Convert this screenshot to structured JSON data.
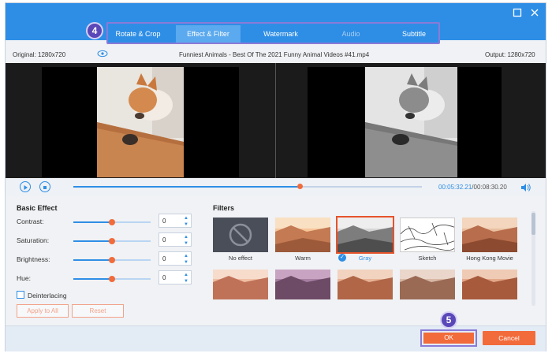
{
  "window": {
    "controls": [
      "maximize-icon",
      "close-icon"
    ],
    "accent": "#2e8ee6"
  },
  "tabs": [
    {
      "label": "Rotate & Crop"
    },
    {
      "label": "Effect & Filter",
      "active": true
    },
    {
      "label": "Watermark"
    },
    {
      "label": "Audio",
      "dimmed": true
    },
    {
      "label": "Subtitle"
    }
  ],
  "badges": {
    "tabs_step": "4",
    "ok_step": "5"
  },
  "info": {
    "original": "Original: 1280x720",
    "filename": "Funniest Animals - Best Of The 2021 Funny Animal Videos #41.mp4",
    "output": "Output: 1280x720"
  },
  "playback": {
    "current_time": "00:05:32.21",
    "separator": "/",
    "total_time": "00:08:30.20",
    "progress": 0.65
  },
  "basic_effect": {
    "title": "Basic Effect",
    "sliders": [
      {
        "label": "Contrast:",
        "value": "0",
        "level": 0.5
      },
      {
        "label": "Saturation:",
        "value": "0",
        "level": 0.5
      },
      {
        "label": "Brightness:",
        "value": "0",
        "level": 0.5
      },
      {
        "label": "Hue:",
        "value": "0",
        "level": 0.5
      }
    ],
    "deinterlacing_label": "Deinterlacing",
    "deinterlacing_checked": false,
    "apply_all_label": "Apply to All",
    "reset_label": "Reset"
  },
  "filters": {
    "title": "Filters",
    "row1": [
      {
        "label": "No effect"
      },
      {
        "label": "Warm"
      },
      {
        "label": "Gray",
        "selected": true
      },
      {
        "label": "Sketch"
      },
      {
        "label": "Hong Kong Movie"
      }
    ]
  },
  "footer": {
    "ok_label": "OK",
    "cancel_label": "Cancel"
  },
  "colors": {
    "accent_blue": "#2e8ee6",
    "orange": "#f26b3a",
    "highlight_purple": "#8a7ad8"
  }
}
